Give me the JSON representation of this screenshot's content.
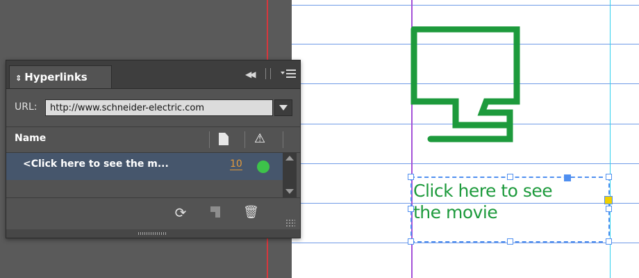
{
  "panel": {
    "tab_label": "Hyperlinks",
    "url_label": "URL:",
    "url_value": "http://www.schneider-electric.com",
    "name_column_header": "Name",
    "rows": [
      {
        "name": "<Click here to see the m...",
        "page": "10",
        "status": "valid"
      }
    ],
    "icons": {
      "tab_arrows": "up-down-arrows-icon",
      "collapse": "double-left-arrow-icon",
      "menu": "panel-menu-icon",
      "page_column": "page-icon",
      "warning_column": "warning-icon",
      "refresh": "refresh-icon",
      "new_hyperlink": "new-hyperlink-icon",
      "delete": "trash-icon"
    },
    "colors": {
      "selected_row": "#46566c",
      "status_ok": "#3dc34a",
      "page_number": "#e39a3b"
    }
  },
  "document": {
    "text_frame_line1": "Click here to see",
    "text_frame_line2": "the movie",
    "text_color": "#1d9a3c",
    "icon": "speech-monitor-icon",
    "icon_color": "#1d9a3c"
  }
}
